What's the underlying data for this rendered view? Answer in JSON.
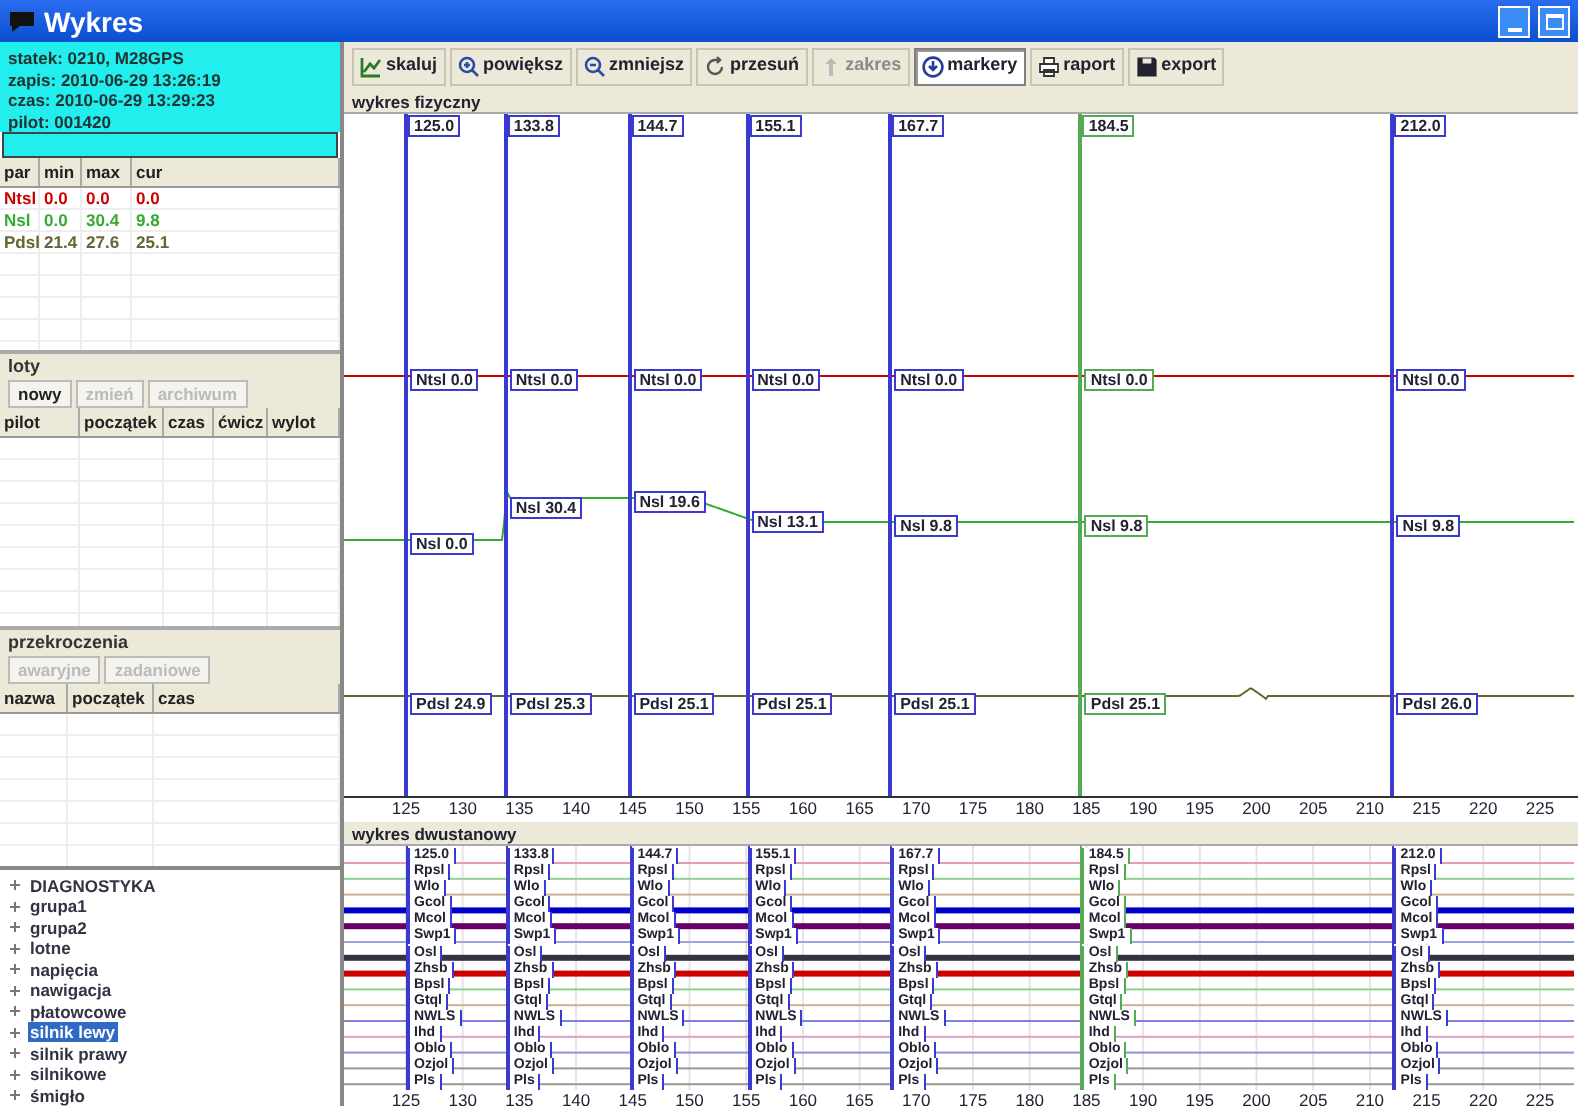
{
  "window": {
    "title": "Wykres"
  },
  "info": {
    "lines": [
      "statek: 0210, M28GPS",
      "zapis: 2010-06-29 13:26:19",
      "czas: 2010-06-29 13:29:23",
      "pilot: 001420"
    ]
  },
  "params": {
    "columns": [
      "par",
      "min",
      "max",
      "cur"
    ],
    "rows": [
      {
        "cells": [
          "Ntsl",
          "0.0",
          "0.0",
          "0.0"
        ],
        "color": "#cc0000"
      },
      {
        "cells": [
          "Nsl",
          "0.0",
          "30.4",
          "9.8"
        ],
        "color": "#33aa33"
      },
      {
        "cells": [
          "Pdsl",
          "21.4",
          "27.6",
          "25.1"
        ],
        "color": "#666633"
      }
    ]
  },
  "flights": {
    "title": "loty",
    "buttons": [
      {
        "label": "nowy",
        "disabled": false
      },
      {
        "label": "zmień",
        "disabled": true
      },
      {
        "label": "archiwum",
        "disabled": true
      }
    ],
    "columns": [
      "pilot",
      "początek",
      "czas",
      "ćwicz",
      "wylot"
    ]
  },
  "exceedances": {
    "title": "przekroczenia",
    "buttons": [
      {
        "label": "awaryjne",
        "disabled": true
      },
      {
        "label": "zadaniowe",
        "disabled": true
      }
    ],
    "columns": [
      "nazwa",
      "początek",
      "czas"
    ]
  },
  "tree": [
    {
      "label": "DIAGNOSTYKA",
      "selected": false,
      "expanded": false
    },
    {
      "label": "grupa1",
      "selected": false,
      "expanded": false
    },
    {
      "label": "grupa2",
      "selected": false,
      "expanded": false
    },
    {
      "label": "lotne",
      "selected": false,
      "expanded": false
    },
    {
      "label": "napięcia",
      "selected": false,
      "expanded": false
    },
    {
      "label": "nawigacja",
      "selected": false,
      "expanded": false
    },
    {
      "label": "płatowcowe",
      "selected": false,
      "expanded": false
    },
    {
      "label": "silnik lewy",
      "selected": true,
      "expanded": false
    },
    {
      "label": "silnik prawy",
      "selected": false,
      "expanded": false
    },
    {
      "label": "silnikowe",
      "selected": false,
      "expanded": false
    },
    {
      "label": "śmigło",
      "selected": false,
      "expanded": false
    }
  ],
  "toolbar": [
    {
      "kind": "scale",
      "label": "skaluj",
      "disabled": false,
      "pressed": false
    },
    {
      "kind": "zoom_in",
      "label": "powiększ",
      "disabled": false,
      "pressed": false
    },
    {
      "kind": "zoom_out",
      "label": "zmniejsz",
      "disabled": false,
      "pressed": false
    },
    {
      "kind": "pan",
      "label": "przesuń",
      "disabled": false,
      "pressed": false
    },
    {
      "kind": "range",
      "label": "zakres",
      "disabled": true,
      "pressed": false
    },
    {
      "kind": "markers",
      "label": "markery",
      "disabled": false,
      "pressed": true
    },
    {
      "kind": "report",
      "label": "raport",
      "disabled": false,
      "pressed": false
    },
    {
      "kind": "export",
      "label": "export",
      "disabled": false,
      "pressed": false
    }
  ],
  "physical_chart": {
    "title": "wykres fizyczny",
    "xticks": [
      "125",
      "130",
      "135",
      "140",
      "145",
      "150",
      "155",
      "160",
      "165",
      "170",
      "175",
      "180",
      "185",
      "190",
      "195",
      "200",
      "205",
      "210",
      "215",
      "220",
      "225"
    ],
    "markers": [
      {
        "value": "125.0",
        "color": "#3a3ad0",
        "labels": [
          "Ntsl 0.0",
          "Nsl 0.0",
          "Pdsl 24.9"
        ]
      },
      {
        "value": "133.8",
        "color": "#3a3ad0",
        "labels": [
          "Ntsl 0.0",
          "Nsl 30.4",
          "Pdsl 25.3"
        ]
      },
      {
        "value": "144.7",
        "color": "#3a3ad0",
        "labels": [
          "Ntsl 0.0",
          "Nsl 19.6",
          "Pdsl 25.1"
        ]
      },
      {
        "value": "155.1",
        "color": "#3a3ad0",
        "labels": [
          "Ntsl 0.0",
          "Nsl 13.1",
          "Pdsl 25.1"
        ]
      },
      {
        "value": "167.7",
        "color": "#3a3ad0",
        "labels": [
          "Ntsl 0.0",
          "Nsl 9.8",
          "Pdsl 25.1"
        ]
      },
      {
        "value": "184.5",
        "color": "#55aa55",
        "labels": [
          "Ntsl 0.0",
          "Nsl 9.8",
          "Pdsl 25.1"
        ]
      },
      {
        "value": "212.0",
        "color": "#3a3ad0",
        "labels": [
          "Ntsl 0.0",
          "Nsl 9.8",
          "Pdsl 26.0"
        ]
      }
    ]
  },
  "binary_chart": {
    "title": "wykres dwustanowy",
    "xticks": [
      "125",
      "130",
      "135",
      "140",
      "145",
      "150",
      "155",
      "160",
      "165",
      "170",
      "175",
      "180",
      "185",
      "190",
      "195",
      "200",
      "205",
      "210",
      "215",
      "220",
      "225"
    ],
    "traces": [
      {
        "color": "#e0a0b0",
        "active": false
      },
      {
        "color": "#90d090",
        "active": false
      },
      {
        "color": "#d0b090",
        "active": false
      },
      {
        "color": "#0000cc",
        "active": true
      },
      {
        "color": "#660066",
        "active": true
      },
      {
        "color": "#a0a0e0",
        "active": false
      },
      {
        "color": "#333344",
        "active": true
      },
      {
        "color": "#cc0000",
        "active": true
      },
      {
        "color": "#90d090",
        "active": false
      },
      {
        "color": "#d0b090",
        "active": false
      },
      {
        "color": "#8080e0",
        "active": false
      },
      {
        "color": "#e0a0c0",
        "active": false
      },
      {
        "color": "#9090e0",
        "active": false
      },
      {
        "color": "#999999",
        "active": false
      },
      {
        "color": "#999999",
        "active": false
      }
    ],
    "markers": [
      {
        "value": "125.0",
        "color": "#3a3ad0",
        "labels": [
          "Rpsl",
          "Wlo",
          "Gcol",
          "Mcol",
          "Swp1",
          "Osl",
          "Zhsb",
          "Bpsl",
          "Gtql",
          "NWLS",
          "Ihd",
          "Oblo",
          "Ozjol",
          "Pls"
        ]
      },
      {
        "value": "133.8",
        "color": "#3a3ad0",
        "labels": [
          "Rpsl",
          "Wlo",
          "Gcol",
          "Mcol",
          "Swp1",
          "Osl",
          "Zhsb",
          "Bpsl",
          "Gtql",
          "NWLS",
          "Ihd",
          "Oblo",
          "Ozjol",
          "Pls"
        ]
      },
      {
        "value": "144.7",
        "color": "#3a3ad0",
        "labels": [
          "Rpsl",
          "Wlo",
          "Gcol",
          "Mcol",
          "Swp1",
          "Osl",
          "Zhsb",
          "Bpsl",
          "Gtql",
          "NWLS",
          "Ihd",
          "Oblo",
          "Ozjol",
          "Pls"
        ]
      },
      {
        "value": "155.1",
        "color": "#3a3ad0",
        "labels": [
          "Rpsl",
          "Wlo",
          "Gcol",
          "Mcol",
          "Swp1",
          "Osl",
          "Zhsb",
          "Bpsl",
          "Gtql",
          "NWLS",
          "Ihd",
          "Oblo",
          "Ozjol",
          "Pls"
        ]
      },
      {
        "value": "167.7",
        "color": "#3a3ad0",
        "labels": [
          "Rpsl",
          "Wlo",
          "Gcol",
          "Mcol",
          "Swp1",
          "Osl",
          "Zhsb",
          "Bpsl",
          "Gtql",
          "NWLS",
          "Ihd",
          "Oblo",
          "Ozjol",
          "Pls"
        ]
      },
      {
        "value": "184.5",
        "color": "#55aa55",
        "labels": [
          "Rpsl",
          "Wlo",
          "Gcol",
          "Mcol",
          "Swp1",
          "Osl",
          "Zhsb",
          "Bpsl",
          "Gtql",
          "NWLS",
          "Ihd",
          "Oblo",
          "Ozjol",
          "Pls"
        ]
      },
      {
        "value": "212.0",
        "color": "#3a3ad0",
        "labels": [
          "Rpsl",
          "Wlo",
          "Gcol",
          "Mcol",
          "Swp1",
          "Osl",
          "Zhsb",
          "Bpsl",
          "Gtql",
          "NWLS",
          "Ihd",
          "Oblo",
          "Ozjol",
          "Pls"
        ]
      }
    ]
  }
}
